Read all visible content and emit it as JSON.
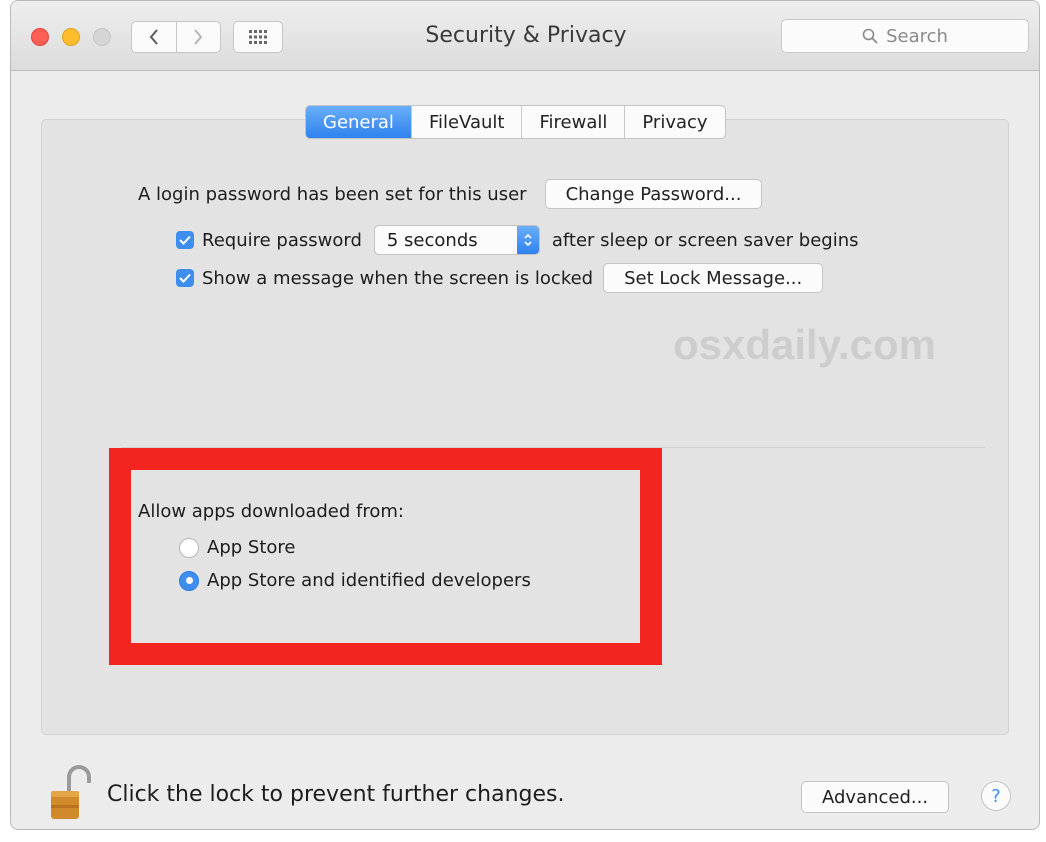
{
  "window": {
    "title": "Security & Privacy"
  },
  "toolbar": {
    "search_placeholder": "Search"
  },
  "tabs": [
    {
      "label": "General",
      "active": true
    },
    {
      "label": "FileVault",
      "active": false
    },
    {
      "label": "Firewall",
      "active": false
    },
    {
      "label": "Privacy",
      "active": false
    }
  ],
  "general": {
    "login_text": "A login password has been set for this user",
    "change_password_label": "Change Password...",
    "require_password": {
      "label": "Require password",
      "checked": true,
      "delay_value": "5 seconds",
      "suffix": "after sleep or screen saver begins"
    },
    "show_message": {
      "label": "Show a message when the screen is locked",
      "checked": true,
      "button_label": "Set Lock Message..."
    }
  },
  "watermark": "osxdaily.com",
  "allow_apps": {
    "heading": "Allow apps downloaded from:",
    "options": [
      {
        "label": "App Store",
        "selected": false
      },
      {
        "label": "App Store and identified developers",
        "selected": true
      }
    ]
  },
  "footer": {
    "lock_message": "Click the lock to prevent further changes.",
    "advanced_label": "Advanced...",
    "help_label": "?"
  },
  "colors": {
    "accent": "#3e8ef0",
    "highlight_border": "#f3261f"
  }
}
